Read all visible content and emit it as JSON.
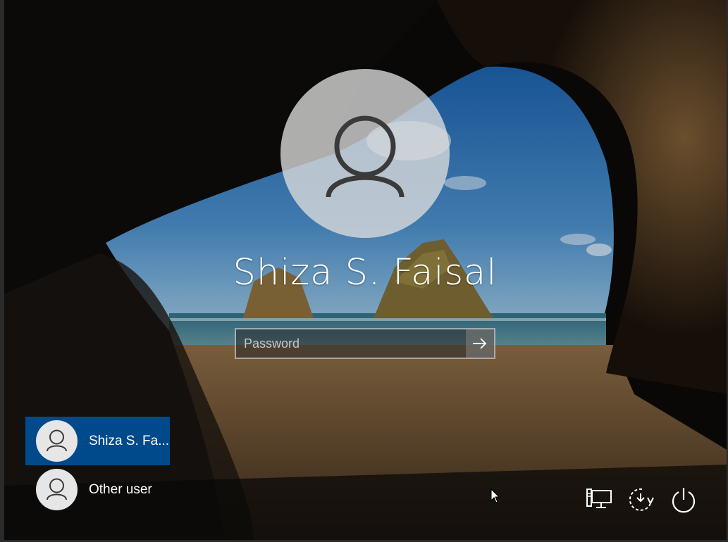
{
  "login": {
    "user_name": "Shiza S. Faisal",
    "password_placeholder": "Password"
  },
  "user_list": {
    "items": [
      {
        "label": "Shiza S. Fa...",
        "selected": true
      },
      {
        "label": "Other user",
        "selected": false
      }
    ]
  },
  "tray": {
    "icons": [
      "network-icon",
      "ease-of-access-icon",
      "power-icon"
    ]
  },
  "colors": {
    "selected_user_bg": "#004a8c",
    "avatar_bg": "#dcdcdc",
    "icon_stroke": "#3a3a3a"
  }
}
